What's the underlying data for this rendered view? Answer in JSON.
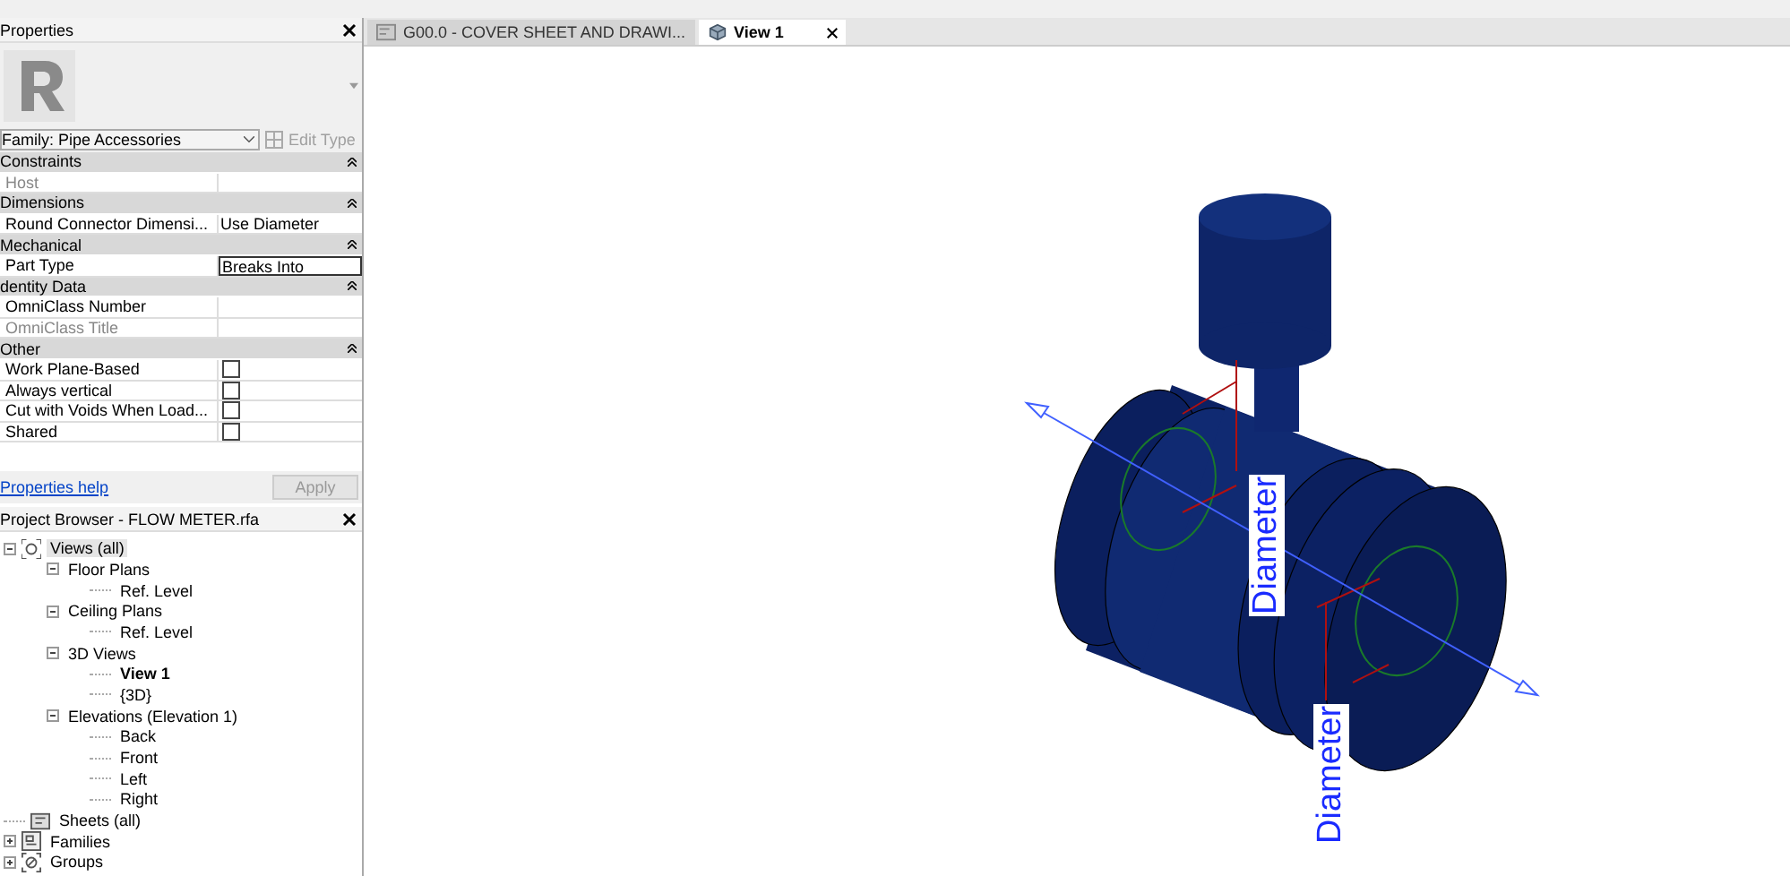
{
  "properties": {
    "title": "Properties",
    "type_selector": "Family: Pipe Accessories",
    "edit_type": {
      "label": "Edit Type",
      "disabled": true
    },
    "groups": [
      {
        "name": "Constraints",
        "expanded": true,
        "rows": [
          {
            "label": "Host",
            "value": "",
            "kind": "text",
            "disabled": true
          }
        ]
      },
      {
        "name": "Dimensions",
        "expanded": true,
        "rows": [
          {
            "label": "Round Connector Dimensi...",
            "value": "Use Diameter",
            "kind": "text",
            "disabled": false
          }
        ]
      },
      {
        "name": "Mechanical",
        "expanded": true,
        "rows": [
          {
            "label": "Part Type",
            "value": "Breaks Into",
            "kind": "text",
            "disabled": false,
            "focused": true
          }
        ]
      },
      {
        "name": "dentity Data",
        "expanded": true,
        "rows": [
          {
            "label": "OmniClass Number",
            "value": "",
            "kind": "text",
            "disabled": false
          },
          {
            "label": "OmniClass Title",
            "value": "",
            "kind": "text",
            "disabled": true
          }
        ]
      },
      {
        "name": "Other",
        "expanded": true,
        "rows": [
          {
            "label": "Work Plane-Based",
            "kind": "check",
            "checked": false
          },
          {
            "label": "Always vertical",
            "kind": "check",
            "checked": false
          },
          {
            "label": "Cut with Voids When Load...",
            "kind": "check",
            "checked": false
          },
          {
            "label": "Shared",
            "kind": "check",
            "checked": false
          }
        ]
      }
    ],
    "help_link": "Properties help",
    "apply_button": {
      "label": "Apply",
      "disabled": true
    }
  },
  "project_browser": {
    "title": "Project Browser - FLOW METER.rfa",
    "tree": [
      {
        "label": "Views (all)",
        "kind": "views",
        "expanded": true,
        "selected": true,
        "current": false,
        "children": [
          {
            "label": "Floor Plans",
            "expanded": true,
            "selected": false,
            "current": false,
            "children": [
              {
                "label": "Ref. Level",
                "selected": false,
                "current": false
              }
            ]
          },
          {
            "label": "Ceiling Plans",
            "expanded": true,
            "selected": false,
            "current": false,
            "children": [
              {
                "label": "Ref. Level",
                "selected": false,
                "current": false
              }
            ]
          },
          {
            "label": "3D Views",
            "expanded": true,
            "selected": false,
            "current": false,
            "children": [
              {
                "label": "View 1",
                "selected": false,
                "current": true
              },
              {
                "label": "{3D}",
                "selected": false,
                "current": false
              }
            ]
          },
          {
            "label": "Elevations (Elevation 1)",
            "expanded": true,
            "selected": false,
            "current": false,
            "children": [
              {
                "label": "Back",
                "selected": false,
                "current": false
              },
              {
                "label": "Front",
                "selected": false,
                "current": false
              },
              {
                "label": "Left",
                "selected": false,
                "current": false
              },
              {
                "label": "Right",
                "selected": false,
                "current": false
              }
            ]
          }
        ]
      },
      {
        "label": "Sheets (all)",
        "kind": "sheets",
        "selected": false,
        "current": false
      },
      {
        "label": "Families",
        "kind": "families",
        "expanded": false,
        "selected": false,
        "current": false
      },
      {
        "label": "Groups",
        "kind": "groups",
        "expanded": false,
        "selected": false,
        "current": false
      }
    ]
  },
  "view_tabs": [
    {
      "label": "G00.0 - COVER SHEET AND DRAWI...",
      "kind": "sheet",
      "selected": false
    },
    {
      "label": "View 1",
      "kind": "model",
      "selected": true
    }
  ],
  "canvas": {
    "dimension_labels": [
      "Diameter",
      "Diameter"
    ]
  }
}
